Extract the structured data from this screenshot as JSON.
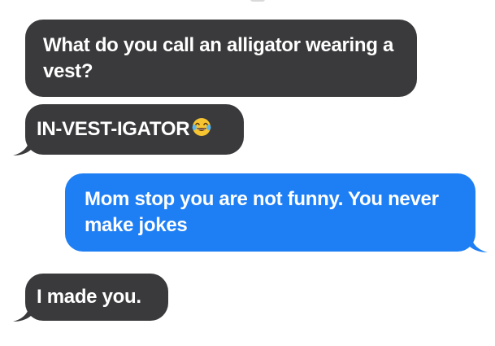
{
  "conversation": {
    "messages": [
      {
        "sender": "incoming",
        "text": "What do you call an alligator wearing a vest?"
      },
      {
        "sender": "incoming",
        "text": "IN-VEST-IGATOR",
        "emoji": "tears-of-joy-emoji"
      },
      {
        "sender": "outgoing",
        "text": "Mom stop you are not funny. You never make jokes"
      },
      {
        "sender": "incoming",
        "text": "I made you."
      }
    ]
  },
  "colors": {
    "incoming_bubble": "#3a3a3c",
    "outgoing_bubble": "#1e7ff5",
    "text": "#ffffff",
    "background": "#ffffff"
  }
}
